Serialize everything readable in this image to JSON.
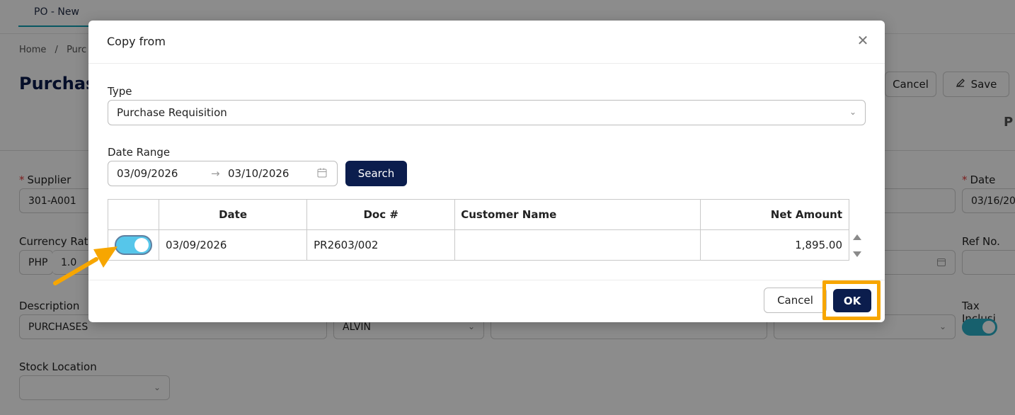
{
  "colors": {
    "primary": "#0b1d4d",
    "accent_highlight": "#f7a600",
    "toggle_on": "#56c6ea",
    "tab_underline": "#0f9fb3"
  },
  "background_page": {
    "tab_label": "PO - New",
    "breadcrumb": [
      "Home",
      "/",
      "Purc"
    ],
    "title_partial": "Purchas",
    "cancel_label": "Cancel",
    "save_label": "Save",
    "peek_text": "P",
    "supplier_label": "Supplier",
    "supplier_value": "301-A001",
    "date_label": "Date",
    "date_value": "03/16/20",
    "currency_rate_label": "Currency Rate",
    "currency_value": "PHP",
    "currency_rate_value": "1.0",
    "ref_no_label": "Ref No.",
    "description_label": "Description",
    "description_value": "PURCHASES",
    "salesman_value": "ALVIN",
    "tax_inclusive_label": "Tax Inclusi",
    "stock_location_label": "Stock Location"
  },
  "modal": {
    "title": "Copy from",
    "close_icon": "close-icon",
    "type_label": "Type",
    "type_value": "Purchase Requisition",
    "date_range_label": "Date Range",
    "date_from": "03/09/2026",
    "date_to": "03/10/2026",
    "search_label": "Search",
    "table": {
      "columns": [
        "",
        "Date",
        "Doc #",
        "Customer Name",
        "Net Amount"
      ],
      "rows": [
        {
          "selected": true,
          "date": "03/09/2026",
          "doc": "PR2603/002",
          "customer": "",
          "net_amount": "1,895.00"
        }
      ]
    },
    "cancel_label": "Cancel",
    "ok_label": "OK"
  }
}
